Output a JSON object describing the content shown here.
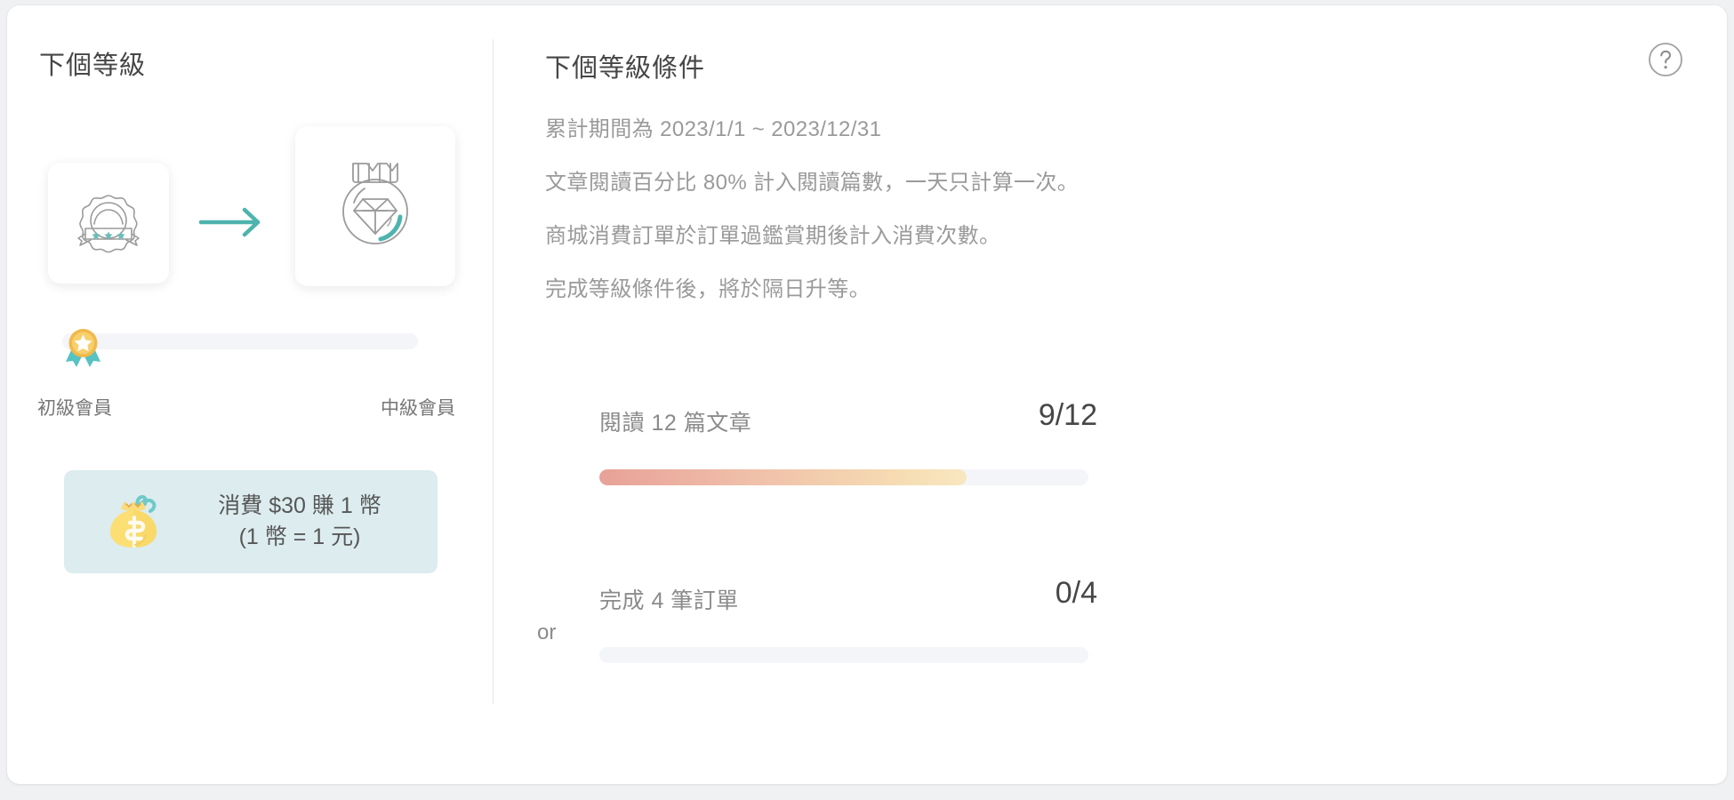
{
  "left": {
    "title": "下個等級",
    "current_level_icon": "rosette-badge-icon",
    "next_level_icon": "diamond-medal-icon",
    "arrow_icon": "arrow-right-icon",
    "medal_icon": "star-medal-icon",
    "progress_percent": 0,
    "level_from": "初級會員",
    "level_to": "中級會員",
    "coin_box": {
      "icon": "money-bag-icon",
      "line1": "消費 $30 賺 1 幣",
      "line2": "(1 幣 = 1 元)"
    }
  },
  "right": {
    "title": "下個等級條件",
    "help_icon": "question-mark-icon",
    "descriptions": [
      "累計期間為 2023/1/1 ~ 2023/12/31",
      "文章閱讀百分比 80% 計入閱讀篇數，一天只計算一次。",
      "商城消費訂單於訂單過鑑賞期後計入消費次數。",
      "完成等級條件後，將於隔日升等。"
    ],
    "tasks": [
      {
        "connector": "",
        "label": "閱讀 12 篇文章",
        "count": "9/12",
        "current": 9,
        "target": 12,
        "percent": 75
      },
      {
        "connector": "or",
        "label": "完成 4 筆訂單",
        "count": "0/4",
        "current": 0,
        "target": 4,
        "percent": 0
      }
    ]
  },
  "colors": {
    "accent_teal": "#4fb3ad",
    "coin_box_bg": "#dcecef",
    "track": "#f4f5f8",
    "bar_gradient_start": "#e8a198",
    "bar_gradient_end": "#f8e7c0",
    "text_dark": "#464646",
    "text_muted": "#9a9a9a"
  }
}
